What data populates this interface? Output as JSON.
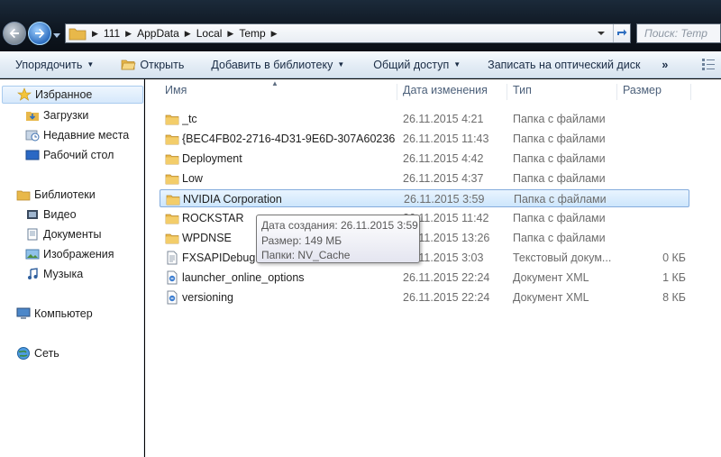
{
  "address": {
    "breadcrumbs": [
      "111",
      "AppData",
      "Local",
      "Temp"
    ],
    "search_placeholder": "Поиск: Temp"
  },
  "toolbar": {
    "organize": "Упорядочить",
    "open": "Открыть",
    "add_to_library": "Добавить в библиотеку",
    "share": "Общий доступ",
    "burn": "Записать на оптический диск",
    "more": "»"
  },
  "nav": {
    "favorites": "Избранное",
    "downloads": "Загрузки",
    "recent": "Недавние места",
    "desktop": "Рабочий стол",
    "libraries": "Библиотеки",
    "video": "Видео",
    "documents": "Документы",
    "pictures": "Изображения",
    "music": "Музыка",
    "computer": "Компьютер",
    "network": "Сеть"
  },
  "columns": {
    "name": "Имя",
    "date": "Дата изменения",
    "type": "Тип",
    "size": "Размер"
  },
  "files": [
    {
      "name": "_tc",
      "date": "26.11.2015 4:21",
      "type": "Папка с файлами",
      "size": "",
      "icon": "folder-icon"
    },
    {
      "name": "{BEC4FB02-2716-4D31-9E6D-307A60236...",
      "date": "26.11.2015 11:43",
      "type": "Папка с файлами",
      "size": "",
      "icon": "folder-icon"
    },
    {
      "name": "Deployment",
      "date": "26.11.2015 4:42",
      "type": "Папка с файлами",
      "size": "",
      "icon": "folder-icon"
    },
    {
      "name": "Low",
      "date": "26.11.2015 4:37",
      "type": "Папка с файлами",
      "size": "",
      "icon": "folder-icon"
    },
    {
      "name": "NVIDIA Corporation",
      "date": "26.11.2015 3:59",
      "type": "Папка с файлами",
      "size": "",
      "icon": "folder-icon"
    },
    {
      "name": "ROCKSTAR",
      "date": "26.11.2015 11:42",
      "type": "Папка с файлами",
      "size": "",
      "icon": "folder-icon"
    },
    {
      "name": "WPDNSE",
      "date": "26.11.2015 13:26",
      "type": "Папка с файлами",
      "size": "",
      "icon": "folder-icon"
    },
    {
      "name": "FXSAPIDebugLo",
      "date": "26.11.2015 3:03",
      "type": "Текстовый докум...",
      "size": "0 КБ",
      "icon": "text-file-icon"
    },
    {
      "name": "launcher_online_options",
      "date": "26.11.2015 22:24",
      "type": "Документ XML",
      "size": "1 КБ",
      "icon": "xml-file-icon"
    },
    {
      "name": "versioning",
      "date": "26.11.2015 22:24",
      "type": "Документ XML",
      "size": "8 КБ",
      "icon": "xml-file-icon"
    }
  ],
  "selected_index": 4,
  "tooltip": {
    "created": "Дата создания: 26.11.2015 3:59",
    "size": "Размер: 149 МБ",
    "folders": "Папки: NV_Cache"
  },
  "colors": {
    "folder": "#e8b84a",
    "selection": "#cde6fc",
    "toolbar_text": "#1a2c45"
  }
}
